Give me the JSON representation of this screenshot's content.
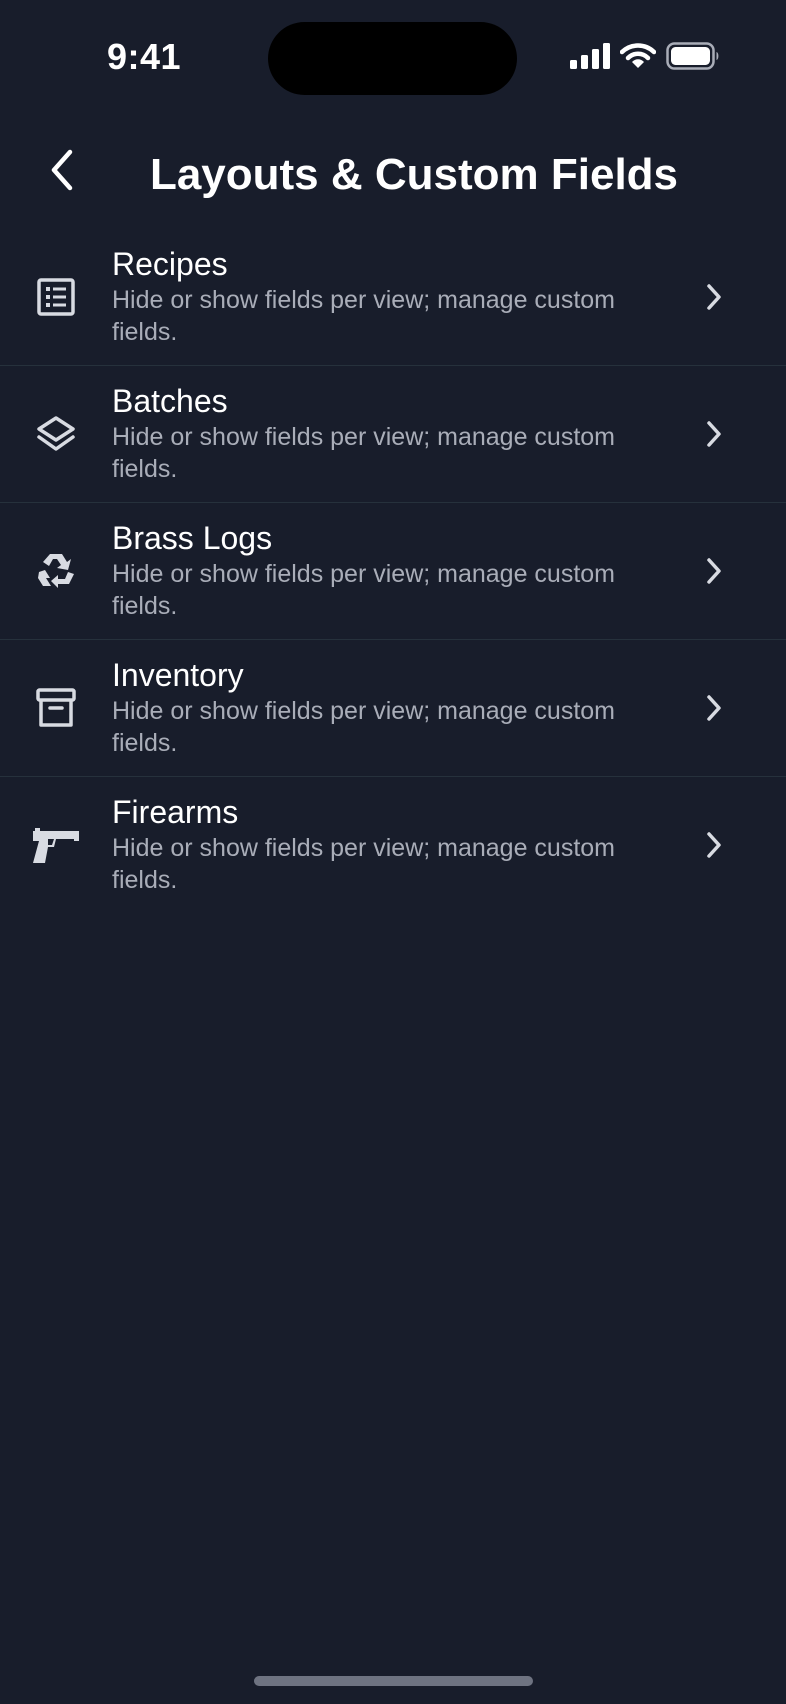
{
  "status_bar": {
    "time": "9:41",
    "icons": [
      "signal-icon",
      "wifi-icon",
      "battery-icon"
    ]
  },
  "nav": {
    "title": "Layouts & Custom Fields",
    "back_icon": "chevron-left-icon"
  },
  "items": [
    {
      "id": "recipes",
      "title": "Recipes",
      "subtitle": "Hide or show fields per view; manage custom fields.",
      "icon": "list-document-icon"
    },
    {
      "id": "batches",
      "title": "Batches",
      "subtitle": "Hide or show fields per view; manage custom fields.",
      "icon": "layers-icon"
    },
    {
      "id": "brass-logs",
      "title": "Brass Logs",
      "subtitle": "Hide or show fields per view; manage custom fields.",
      "icon": "recycle-icon"
    },
    {
      "id": "inventory",
      "title": "Inventory",
      "subtitle": "Hide or show fields per view; manage custom fields.",
      "icon": "archive-box-icon"
    },
    {
      "id": "firearms",
      "title": "Firearms",
      "subtitle": "Hide or show fields per view; manage custom fields.",
      "icon": "pistol-icon"
    }
  ],
  "colors": {
    "background": "#181d2b",
    "primary_text": "#ffffff",
    "secondary_text": "#a9adb8",
    "icon": "#d8dbe2",
    "divider": "#26313c",
    "home_indicator": "#6e7381"
  }
}
